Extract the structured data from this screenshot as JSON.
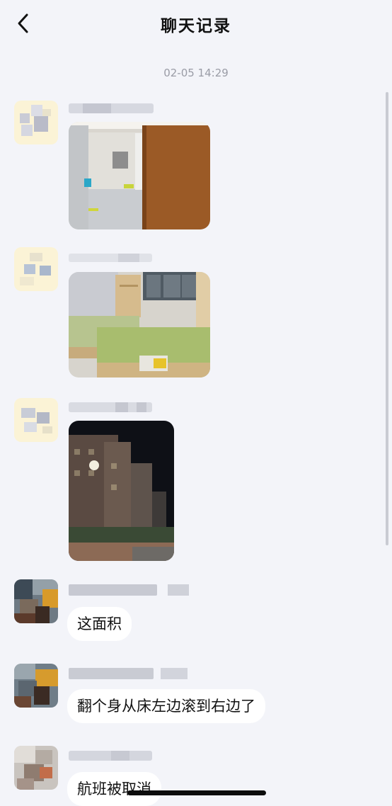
{
  "header": {
    "title": "聊天记录"
  },
  "timestamp": "02-05 14:29",
  "messages": [
    {
      "type": "image",
      "sender_name": "",
      "description": "bathroom photo"
    },
    {
      "type": "image",
      "sender_name": "",
      "description": "dorm beds photo"
    },
    {
      "type": "image",
      "sender_name": "",
      "description": "building at night photo"
    },
    {
      "type": "text",
      "sender_name": "",
      "text": "这面积"
    },
    {
      "type": "text",
      "sender_name": "",
      "text": "翻个身从床左边滚到右边了"
    },
    {
      "type": "text",
      "sender_name": "",
      "text": "航班被取消"
    }
  ],
  "colors": {
    "background": "#f3f4f9",
    "bubble": "#ffffff",
    "timestamp": "#9a9ca6"
  }
}
